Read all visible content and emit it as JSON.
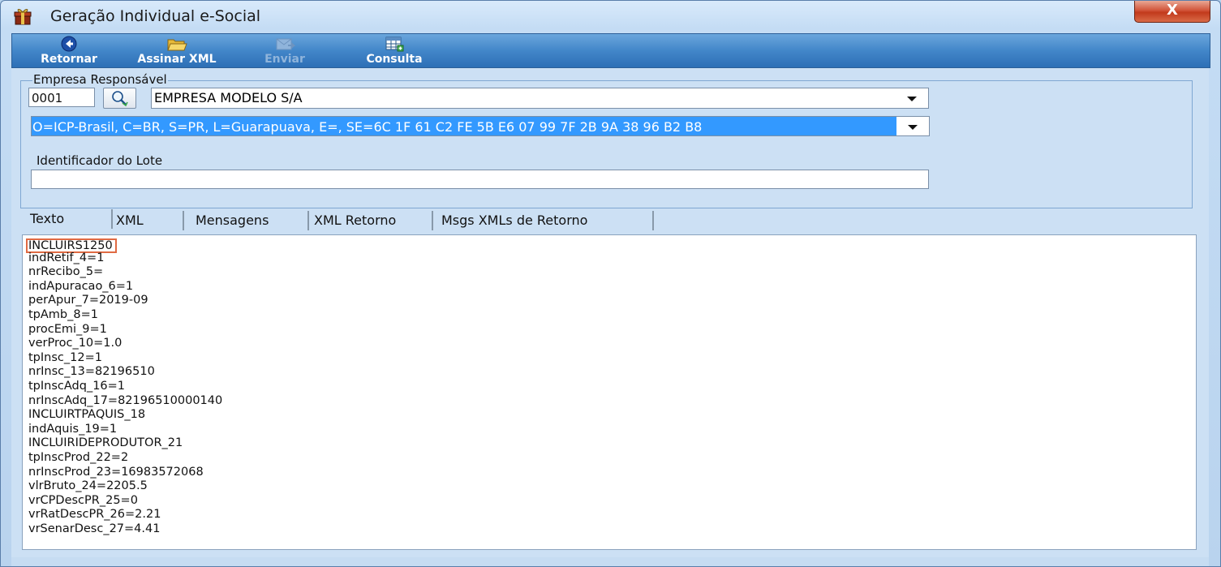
{
  "window": {
    "title": "Geração Individual e-Social",
    "close_symbol": "X"
  },
  "toolbar": {
    "buttons": [
      {
        "label": "Retornar",
        "icon": "back-arrow-icon",
        "enabled": true
      },
      {
        "label": "Assinar XML",
        "icon": "open-folder-icon",
        "enabled": true
      },
      {
        "label": "Enviar",
        "icon": "send-icon",
        "enabled": false
      },
      {
        "label": "Consulta",
        "icon": "grid-search-icon",
        "enabled": true
      }
    ]
  },
  "empresa": {
    "legend": "Empresa Responsável",
    "code": "0001",
    "company_name": "EMPRESA MODELO S/A",
    "certificate": "O=ICP-Brasil, C=BR, S=PR, L=Guarapuava, E=, SE=6C 1F 61 C2 FE 5B E6 07 99 7F 2B 9A 38 96 B2 B8",
    "lote_label": "Identificador do Lote",
    "lote_value": ""
  },
  "tabs": [
    {
      "label": "Texto",
      "active": true
    },
    {
      "label": "XML",
      "active": false
    },
    {
      "label": "Mensagens",
      "active": false
    },
    {
      "label": "XML Retorno",
      "active": false
    },
    {
      "label": "Msgs XMLs de Retorno",
      "active": false
    }
  ],
  "editor": {
    "lines": [
      "INCLUIRS1250",
      "indRetif_4=1",
      "nrRecibo_5=",
      "indApuracao_6=1",
      "perApur_7=2019-09",
      "tpAmb_8=1",
      "procEmi_9=1",
      "verProc_10=1.0",
      "tpInsc_12=1",
      "nrInsc_13=82196510",
      "tpInscAdq_16=1",
      "nrInscAdq_17=82196510000140",
      "INCLUIRTPAQUIS_18",
      "indAquis_19=1",
      "INCLUIRIDEPRODUTOR_21",
      "tpInscProd_22=2",
      "nrInscProd_23=16983572068",
      "vlrBruto_24=2205.5",
      "vrCPDescPR_25=0",
      "vrRatDescPR_26=2.21",
      "vrSenarDesc_27=4.41"
    ]
  },
  "colors": {
    "toolbar": "#3f83c7",
    "selection": "#3399ff",
    "highlight_border": "#e06a43"
  }
}
